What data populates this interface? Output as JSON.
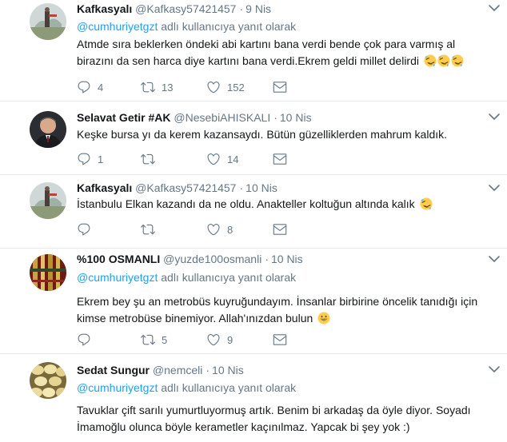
{
  "tweets": [
    {
      "name": "Kafkasyalı",
      "handle": "@Kafkasy57421457",
      "separator": "·",
      "time": "9 Nis",
      "reply_mention": "@cumhuriyetgzt",
      "reply_suffix": " adlı kullanıcıya yanıt olarak",
      "text_lines": [
        "Atmde sıra beklerken öndeki abi kartını bana verdi bende çok para varmış al",
        "birazını da sen harca diye kartını bana verdi.Ekrem geldi millet delirdi"
      ],
      "emoji": [
        "rolling-on-floor-laughing-emoji",
        "rolling-on-floor-laughing-emoji",
        "rolling-on-floor-laughing-emoji"
      ],
      "replies": "4",
      "retweets": "13",
      "likes": "152"
    },
    {
      "name": "Selavat Getir #AK",
      "handle": "@NesebiAHISKALI",
      "separator": "·",
      "time": "10 Nis",
      "text_lines": [
        "Keşke bursa yı da kerem kazansaydı. Bütün güzelliklerden mahrum kaldık."
      ],
      "replies": "1",
      "retweets": "",
      "likes": "14"
    },
    {
      "name": "Kafkasyalı",
      "handle": "@Kafkasy57421457",
      "separator": "·",
      "time": "10 Nis",
      "text_lines": [
        "İstanbulu Elkan kazandı da ne oldu. Anakteller koltuğun altında kalık"
      ],
      "emoji": [
        "rolling-on-floor-laughing-emoji"
      ],
      "replies": "",
      "retweets": "",
      "likes": "8"
    },
    {
      "name": "%100 OSMANLI",
      "handle": "@yuzde100osmanli",
      "separator": "·",
      "time": "10 Nis",
      "reply_mention": "@cumhuriyetgzt",
      "reply_suffix": " adlı kullanıcıya yanıt olarak",
      "text_lines": [
        "Ekrem bey şu an metrobüs kuyruğundayım. İnsanlar birbirine öncelik tanıdığı için",
        "kimse metrobüse binemiyor. Allah'ınızdan bulun"
      ],
      "emoji": [
        "grinning-face-emoji"
      ],
      "replies": "",
      "retweets": "5",
      "likes": "9"
    },
    {
      "name": "Sedat Sungur",
      "handle": "@nemceli",
      "separator": "·",
      "time": "10 Nis",
      "reply_mention": "@cumhuriyetgzt",
      "reply_suffix": " adlı kullanıcıya yanıt olarak",
      "text_lines": [
        "Tavuklar çift sarılı yumurtluyormuş artık. Benim bi arkadaş da öyle diyor. Soyadı",
        "İmamoğlu olunca böyle kerametler kaçınılmaz. Yapcak bi şey yok :)"
      ]
    }
  ],
  "colors": {
    "link": "#1da1f2",
    "secondary_text": "#657786",
    "primary_text": "#14171a",
    "divider": "#e6ecf0"
  },
  "icons": [
    "reply-icon",
    "retweet-icon",
    "like-icon",
    "direct-message-icon",
    "caret-down-icon"
  ]
}
